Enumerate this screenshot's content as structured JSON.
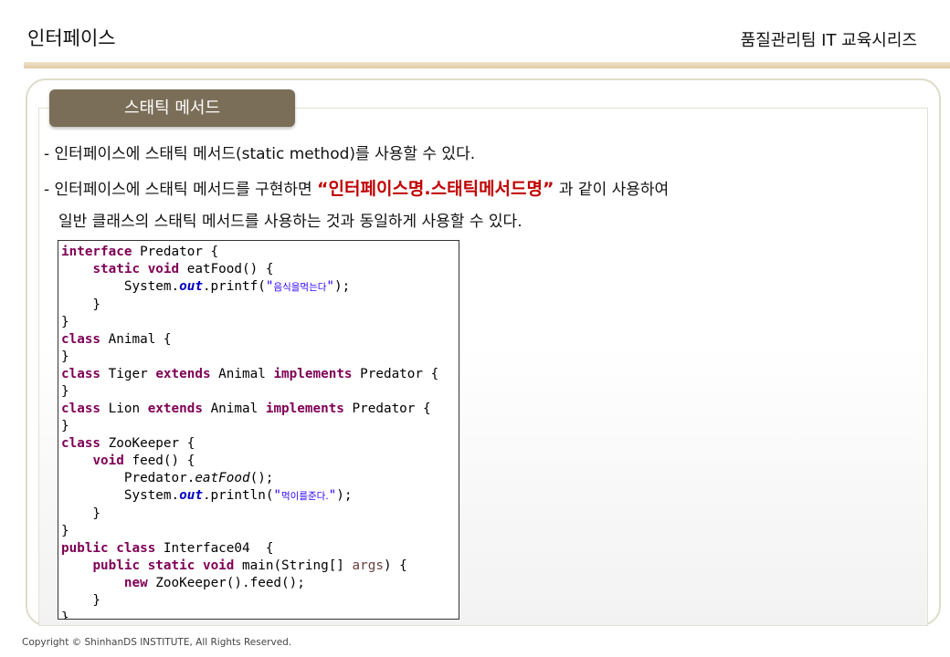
{
  "header": {
    "title": "인터페이스",
    "series": "품질관리팀 IT 교육시리즈"
  },
  "section": {
    "tab_label": "스태틱 메서드"
  },
  "bullets": {
    "b1": "- 인터페이스에 스태틱 메서드(static method)를 사용할 수 있다.",
    "b2_prefix": "- 인터페이스에 스태틱 메서드를 구현하면 ",
    "b2_emphasis": "“인터페이스명.스태틱메서드명”",
    "b2_suffix": " 과 같이 사용하여",
    "b3": "일반 클래스의 스태틱 메서드를 사용하는 것과 동일하게 사용할 수 있다."
  },
  "code": {
    "kw_interface": "interface",
    "kw_static": "static",
    "kw_void": "void",
    "kw_class": "class",
    "kw_extends": "extends",
    "kw_implements": "implements",
    "kw_public": "public",
    "kw_new": "new",
    "out": "out",
    "l1": " Predator {",
    "l2": " eatFood() {",
    "l3_pre": "        System.",
    "l3_mid": ".printf(",
    "l3_str": "음식을먹는다",
    "l3_end": ");",
    "brace_inner": "    }",
    "brace": "}",
    "animal": " Animal {",
    "tiger": " Tiger ",
    "lion": " Lion ",
    "animal_mid": " Animal ",
    "predator_open": " Predator {",
    "zookeeper": " ZooKeeper {",
    "feed": " feed() {",
    "l_pred_pre": "        Predator.",
    "l_pred_it": "eatFood",
    "l_pred_end": "();",
    "l_sys_pre": "        System.",
    "l_sys_mid": ".println(",
    "l_sys_str": "먹이를준다.",
    "l_sys_end": ");",
    "iface04": " Interface04  {",
    "main_sig": " main(String[] ",
    "args": "args",
    "main_end": ") {",
    "zoo_new": " ZooKeeper().feed();"
  },
  "footer": {
    "copyright": "Copyright © ShinhanDS INSTITUTE, All Rights Reserved."
  }
}
